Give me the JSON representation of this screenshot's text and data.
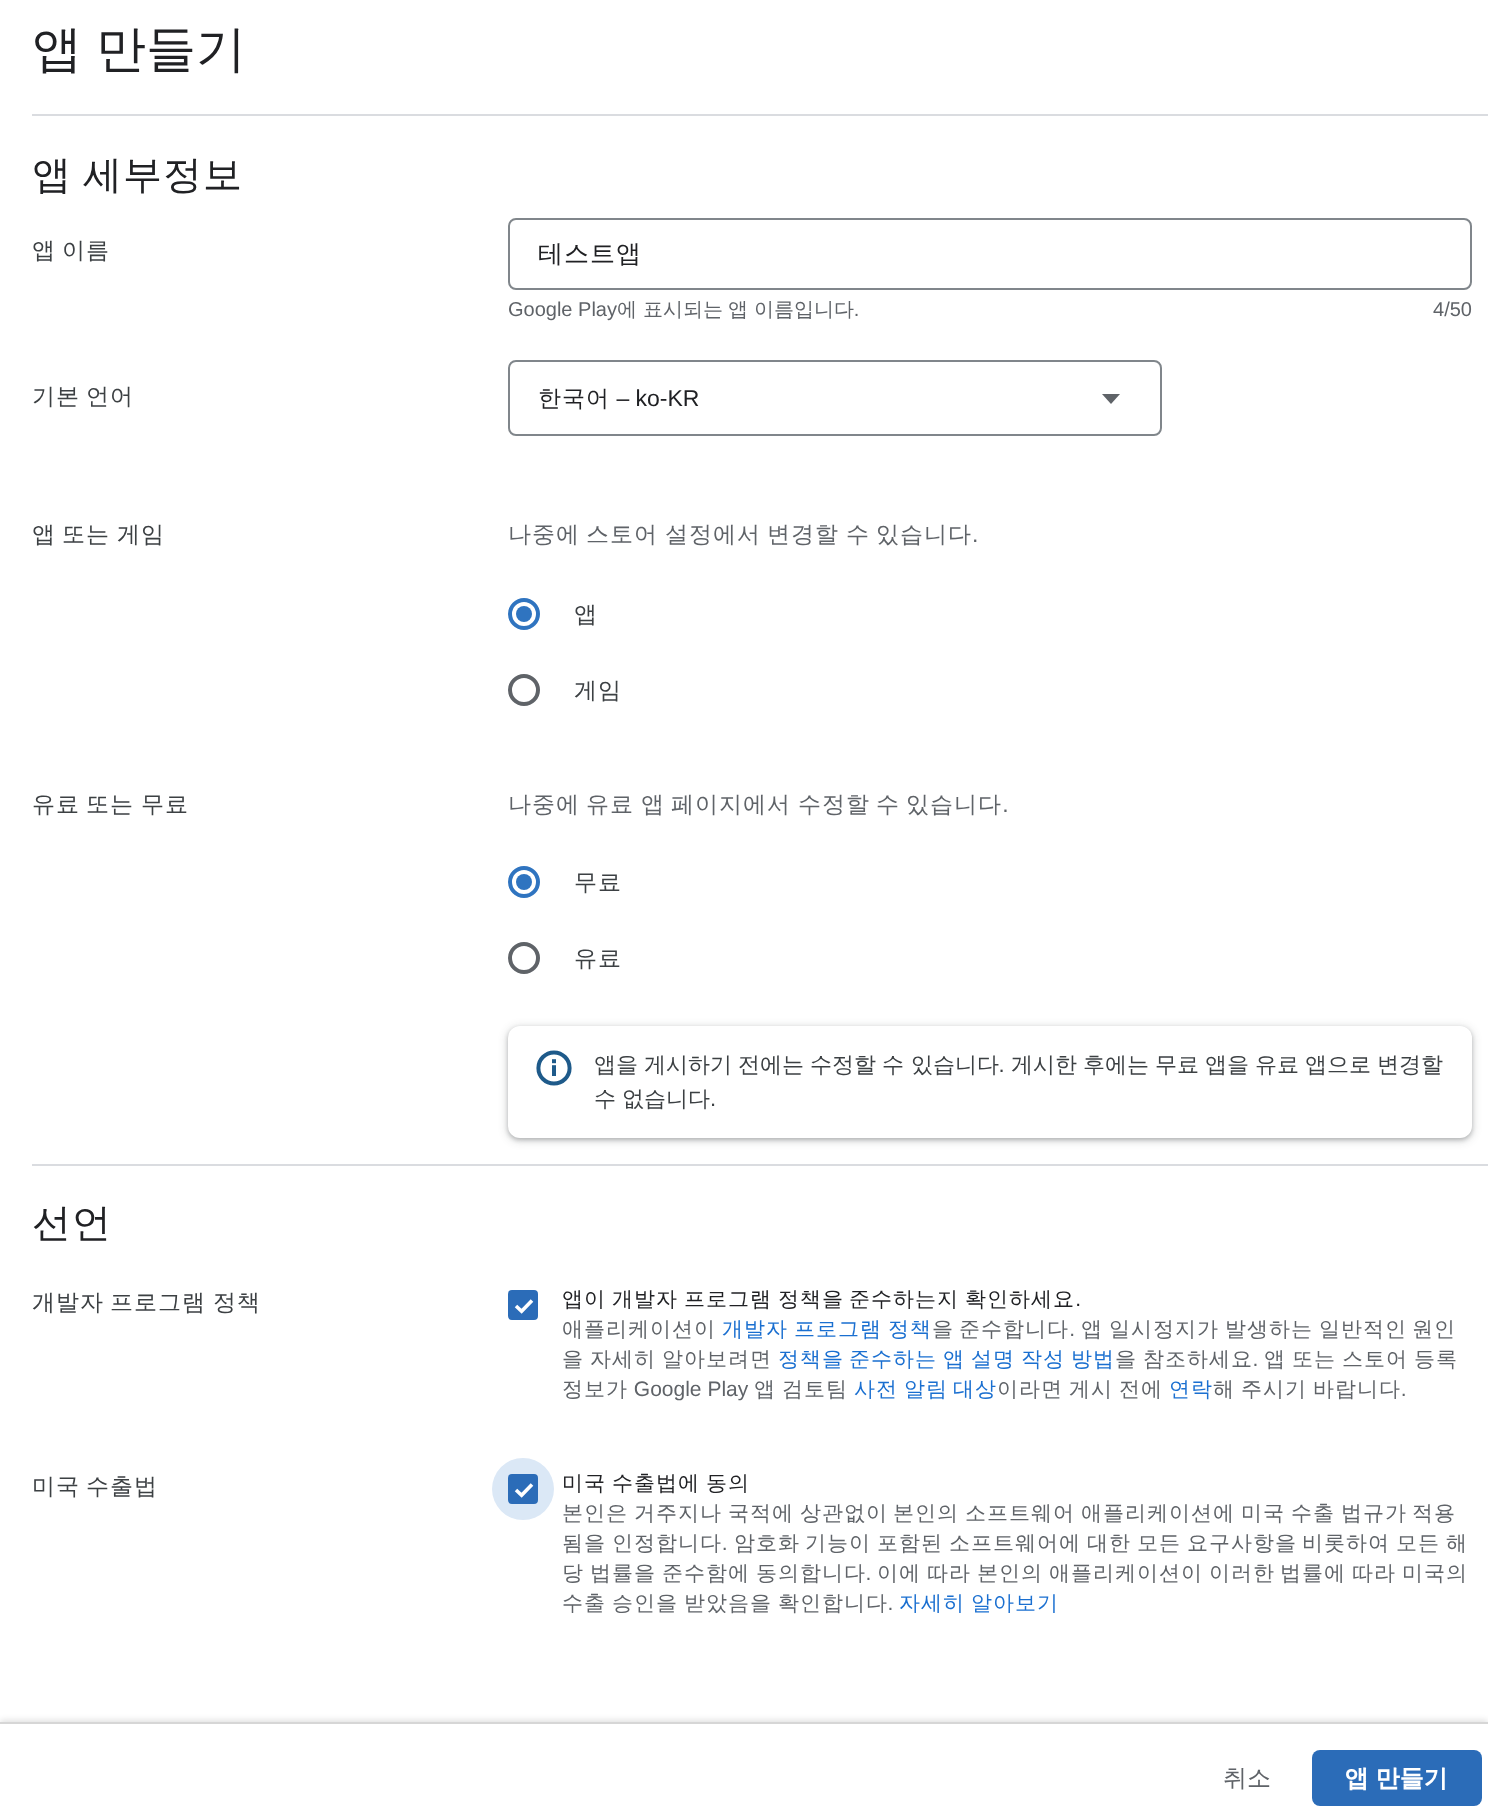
{
  "page": {
    "title": "앱 만들기"
  },
  "sections": [
    {
      "heading": "앱 세부정보",
      "fields": [
        {
          "kind": "text",
          "label": "앱 이름",
          "value": "테스트앱",
          "helper_text": "Google Play에 표시되는 앱 이름입니다.",
          "counter": "4/50"
        },
        {
          "kind": "select",
          "label": "기본 언어",
          "value": "한국어 – ko-KR"
        },
        {
          "kind": "radio",
          "label": "앱 또는 게임",
          "description": "나중에 스토어 설정에서 변경할 수 있습니다.",
          "options": [
            {
              "label": "앱",
              "selected": true
            },
            {
              "label": "게임",
              "selected": false
            }
          ]
        },
        {
          "kind": "radio",
          "label": "유료 또는 무료",
          "description": "나중에 유료 앱 페이지에서 수정할 수 있습니다.",
          "options": [
            {
              "label": "무료",
              "selected": true
            },
            {
              "label": "유료",
              "selected": false
            }
          ],
          "notice": "앱을 게시하기 전에는 수정할 수 있습니다. 게시한 후에는 무료 앱을 유료 앱으로 변경할 수 없습니다."
        }
      ]
    },
    {
      "heading": "선언",
      "fields": [
        {
          "kind": "checkbox",
          "label": "개발자 프로그램 정책",
          "checked": true,
          "focused": false,
          "title": "앱이 개발자 프로그램 정책을 준수하는지 확인하세요.",
          "body": [
            {
              "kind": "text",
              "text": "애플리케이션이 "
            },
            {
              "kind": "link",
              "text": "개발자 프로그램 정책"
            },
            {
              "kind": "text",
              "text": "을 준수합니다. 앱 일시정지가 발생하는 일반적인 원인을 자세히 알아보려면 "
            },
            {
              "kind": "link",
              "text": "정책을 준수하는 앱 설명 작성 방법"
            },
            {
              "kind": "text",
              "text": "을 참조하세요. 앱 또는 스토어 등록정보가 Google Play 앱 검토팀 "
            },
            {
              "kind": "link",
              "text": "사전 알림 대상"
            },
            {
              "kind": "text",
              "text": "이라면 게시 전에 "
            },
            {
              "kind": "link",
              "text": "연락"
            },
            {
              "kind": "text",
              "text": "해 주시기 바랍니다."
            }
          ]
        },
        {
          "kind": "checkbox",
          "label": "미국 수출법",
          "checked": true,
          "focused": true,
          "title": "미국 수출법에 동의",
          "body": [
            {
              "kind": "text",
              "text": "본인은 거주지나 국적에 상관없이 본인의 소프트웨어 애플리케이션에 미국 수출 법규가 적용됨을 인정합니다. 암호화 기능이 포함된 소프트웨어에 대한 모든 요구사항을 비롯하여 모든 해당 법률을 준수함에 동의합니다. 이에 따라 본인의 애플리케이션이 이러한 법률에 따라 미국의 수출 승인을 받았음을 확인합니다. "
            },
            {
              "kind": "link",
              "text": "자세히 알아보기"
            }
          ]
        }
      ]
    }
  ],
  "footer": {
    "buttons": [
      {
        "kind": "secondary",
        "label": "취소"
      },
      {
        "kind": "primary",
        "label": "앱 만들기"
      }
    ]
  }
}
